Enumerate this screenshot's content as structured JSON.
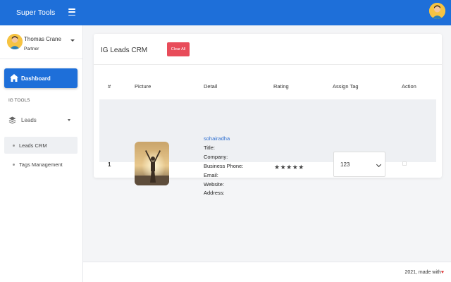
{
  "brand": {
    "title": "Super Tools"
  },
  "user": {
    "name": "Thomas Crane",
    "role": "Partner"
  },
  "sidebar": {
    "dashboard_label": "Dashboard",
    "section_label": "IG TOOLS",
    "leads_label": "Leads",
    "items": [
      {
        "label": "Leads CRM",
        "active": true
      },
      {
        "label": "Tags Management",
        "active": false
      }
    ]
  },
  "card": {
    "title": "IG Leads CRM",
    "clear_button": "Clear All",
    "columns": [
      "#",
      "Picture",
      "Detail",
      "Rating",
      "Assign Tag",
      "Action"
    ],
    "rows": [
      {
        "index": "1",
        "username": "sohairadha",
        "detail_lines": [
          "Title:",
          "Company:",
          "Business Phone:",
          "Email:",
          "Website:",
          "Address:"
        ],
        "rating_stars": "★★★★★",
        "assign_tag": "123"
      }
    ]
  },
  "footer": {
    "text": "2021, made with",
    "heart": "♥"
  },
  "colors": {
    "primary": "#1e6fd9",
    "danger": "#e84c5a",
    "link": "#2f6fd0"
  }
}
